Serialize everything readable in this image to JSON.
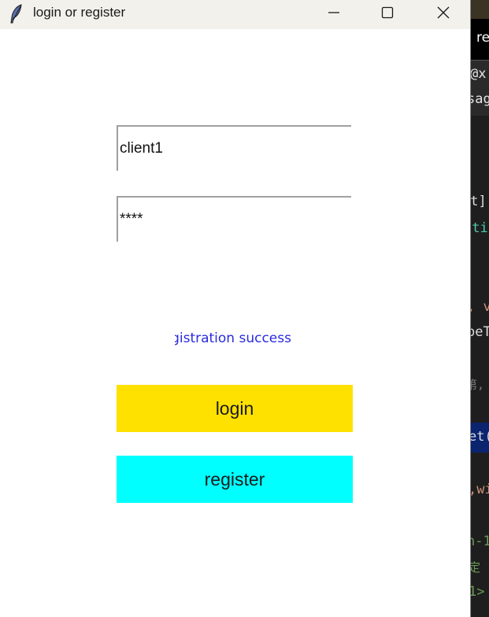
{
  "window": {
    "title": "login or register"
  },
  "form": {
    "username_value": "client1",
    "password_value": "****",
    "status_message": "registration success",
    "login_label": "login",
    "register_label": "register"
  },
  "colors": {
    "login_button": "#ffe100",
    "register_button": "#00ffff",
    "status_text": "#2a2ae0"
  },
  "icons": {
    "app": "feather-icon",
    "minimize": "minimize-icon",
    "maximize": "maximize-icon",
    "close": "close-icon"
  },
  "background_editor": {
    "tab_label": "re",
    "lines": [
      "@x",
      "sag",
      "ot]",
      "ati",
      ", v",
      "peT",
      "第,",
      "et(",
      ",wi",
      "n-1",
      "定",
      "1>"
    ]
  }
}
